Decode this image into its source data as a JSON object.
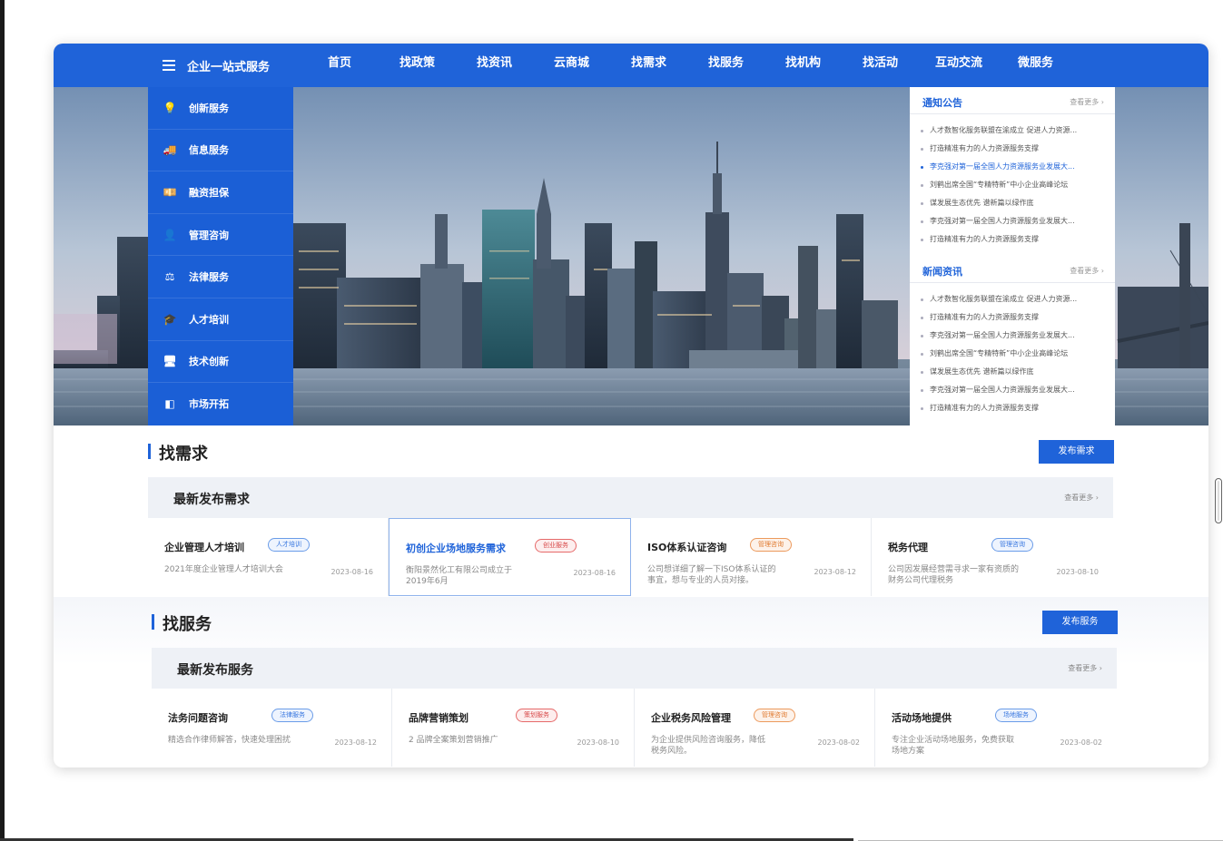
{
  "nav": {
    "all_label": "企业一站式服务",
    "items": [
      "首页",
      "找政策",
      "找资讯",
      "云商城",
      "找需求",
      "找服务",
      "找机构",
      "找活动",
      "互动交流",
      "微服务"
    ]
  },
  "side_menu": [
    {
      "label": "创新服务",
      "icon": "lightbulb-icon",
      "glyph": "💡"
    },
    {
      "label": "信息服务",
      "icon": "truck-icon",
      "glyph": "🚚"
    },
    {
      "label": "融资担保",
      "icon": "money-icon",
      "glyph": "💴"
    },
    {
      "label": "管理咨询",
      "icon": "user-gear-icon",
      "glyph": "👤"
    },
    {
      "label": "法律服务",
      "icon": "scales-icon",
      "glyph": "⚖"
    },
    {
      "label": "人才培训",
      "icon": "graduation-cap-icon",
      "glyph": "🎓"
    },
    {
      "label": "技术创新",
      "icon": "monitor-icon",
      "glyph": "🖥"
    },
    {
      "label": "市场开拓",
      "icon": "browser-icon",
      "glyph": "◧"
    }
  ],
  "notice": {
    "title": "通知公告",
    "more": "查看更多 ›",
    "items": [
      "人才数智化服务联盟在渝成立 促进人力资源...",
      "打造精准有力的人力资源服务支撑",
      "李克强对第一届全国人力资源服务业发展大...",
      "刘鹤出席全国“专精特新”中小企业高峰论坛",
      "谋发展生态优先 谱新篇以绿作底",
      "李克强对第一届全国人力资源服务业发展大...",
      "打造精准有力的人力资源服务支撑"
    ],
    "active_index": 2
  },
  "news": {
    "title": "新闻资讯",
    "more": "查看更多 ›",
    "items": [
      "人才数智化服务联盟在渝成立 促进人力资源...",
      "打造精准有力的人力资源服务支撑",
      "李克强对第一届全国人力资源服务业发展大...",
      "刘鹤出席全国“专精特新”中小企业高峰论坛",
      "谋发展生态优先 谱新篇以绿作底",
      "李克强对第一届全国人力资源服务业发展大...",
      "打造精准有力的人力资源服务支撑"
    ]
  },
  "demand": {
    "title": "找需求",
    "publish_label": "发布需求",
    "sub_title": "最新发布需求",
    "more": "查看更多 ›",
    "cards": [
      {
        "title": "企业管理人才培训",
        "tag": "人才培训",
        "tag_color": "blue",
        "desc": [
          "2021年度企业管理人才培训大会"
        ],
        "date": "2023-08-16"
      },
      {
        "title": "初创企业场地服务需求",
        "tag": "创业服务",
        "tag_color": "red",
        "desc": [
          "衡阳景然化工有限公司成立于",
          "2019年6月"
        ],
        "date": "2023-08-16"
      },
      {
        "title": "ISO体系认证咨询",
        "tag": "管理咨询",
        "tag_color": "orange",
        "desc": [
          "公司想详细了解一下ISO体系认证的",
          "事宜，想与专业的人员对接。"
        ],
        "date": "2023-08-12"
      },
      {
        "title": "税务代理",
        "tag": "管理咨询",
        "tag_color": "blue",
        "desc": [
          "公司因发展经营需寻求一家有资质的",
          "财务公司代理税务"
        ],
        "date": "2023-08-10"
      }
    ]
  },
  "service": {
    "title": "找服务",
    "publish_label": "发布服务",
    "sub_title": "最新发布服务",
    "more": "查看更多 ›",
    "cards": [
      {
        "title": "法务问题咨询",
        "tag": "法律服务",
        "tag_color": "blue",
        "desc": [
          "精选合作律师解答，快速处理困扰"
        ],
        "date": "2023-08-12"
      },
      {
        "title": "品牌营销策划",
        "tag": "策划服务",
        "tag_color": "red",
        "desc": [
          "2 品牌全案策划营销推广"
        ],
        "date": "2023-08-10"
      },
      {
        "title": "企业税务风险管理",
        "tag": "管理咨询",
        "tag_color": "orange",
        "desc": [
          "为企业提供风险咨询服务，降低",
          "税务风险。"
        ],
        "date": "2023-08-02"
      },
      {
        "title": "活动场地提供",
        "tag": "场地服务",
        "tag_color": "blue",
        "desc": [
          "专注企业活动场地服务，免费获取",
          "场地方案"
        ],
        "date": "2023-08-02"
      }
    ]
  }
}
